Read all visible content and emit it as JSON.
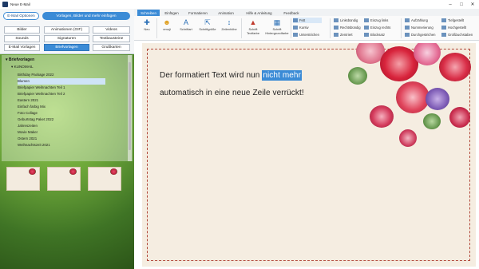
{
  "window": {
    "title": "Neue E-Mail"
  },
  "left": {
    "top_tabs": [
      "E-Mail Optionen",
      "Vorlagen, Bilder und mehr einfügen"
    ],
    "categories": [
      [
        "Bilder",
        "Animationen (GIF)",
        "Videos"
      ],
      [
        "Sounds",
        "Signaturen",
        "Textbausteine"
      ],
      [
        "E-Mail Vorlagen",
        "Briefvorlagen",
        "Grußkarten"
      ]
    ],
    "tree_root": "Briefvorlagen",
    "tree_sub": "KUNOMAIL",
    "tree_items": [
      "Birthday Package 2022",
      "Blumen",
      "Briefpapier Weihnachten Teil 1",
      "Briefpapier Weihnachten Teil 2",
      "Eastern 2021",
      "Einfach farbig Mix",
      "Foto Collage",
      "Geburtstag Paket 2022",
      "Jahreszeiten",
      "Movie Maker",
      "Ostern 2021",
      "Weihnachtszeit 2021"
    ]
  },
  "ribbon": {
    "tabs": [
      "Schreiben",
      "Einfügen",
      "Formatieren",
      "Animation",
      "Hilfe & Anleitung",
      "Feedback"
    ],
    "buttons": [
      "Neu",
      "emoji",
      "Schriftart",
      "Schriftgröße",
      "Zeilenhöhe",
      "Schrift Textfarbe",
      "Schrift Hintergrundfarbe"
    ],
    "fmt_col1": [
      "Fett",
      "Kursiv",
      "Unterstrichen"
    ],
    "fmt_col2": [
      "Linksbündig",
      "Rechtsbündig",
      "Zentriert"
    ],
    "fmt_col3": [
      "Einzug links",
      "Einzug rechts",
      "Blocksatz"
    ],
    "fmt_col4": [
      "Aufzählung",
      "Nummerierung",
      "Durchgestrichen"
    ],
    "fmt_col5": [
      "Tiefgestellt",
      "Hochgestellt",
      "Großbuchstaben"
    ]
  },
  "editor": {
    "line1_before": "Der formatiert Text wird nun ",
    "line1_selected": "nicht mehr",
    "line2": "automatisch in eine neue Zeile verrückt!"
  }
}
